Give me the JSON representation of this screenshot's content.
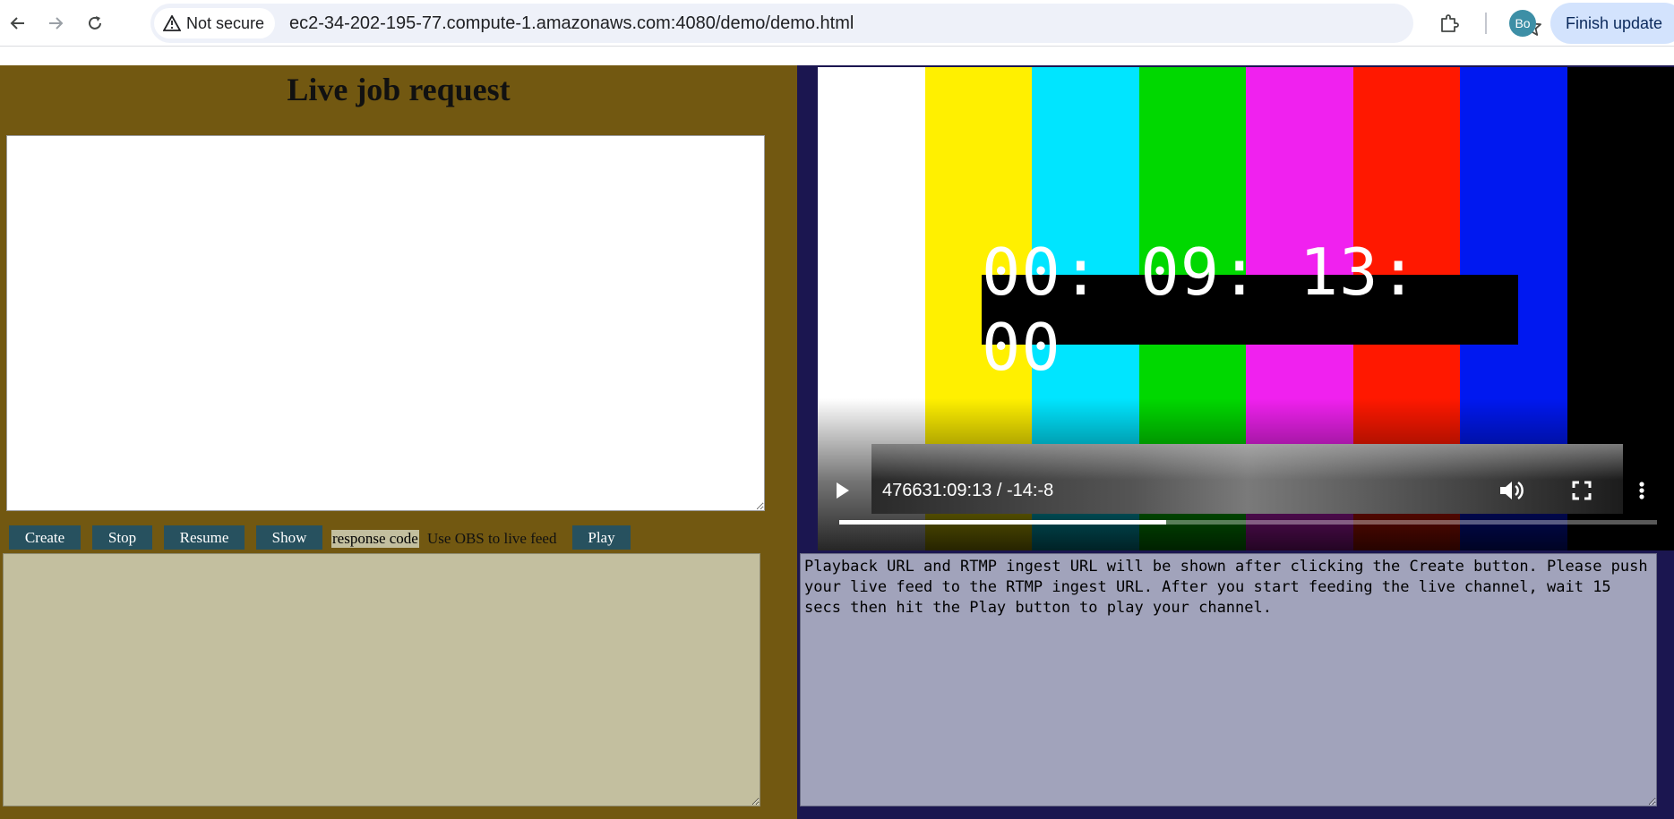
{
  "browser": {
    "security_label": "Not secure",
    "url": "ec2-34-202-195-77.compute-1.amazonaws.com:4080/demo/demo.html",
    "profile_initials": "Bo",
    "update_label": "Finish update"
  },
  "left": {
    "title": "Live job request",
    "job_text": "",
    "buttons": {
      "create": "Create",
      "stop": "Stop",
      "resume": "Resume",
      "show": "Show",
      "play": "Play"
    },
    "response_code_label": "response code",
    "obs_hint": "Use OBS to live feed",
    "response_text": ""
  },
  "video": {
    "timecode": "00: 09: 13: 00",
    "time_display": "476631:09:13 / -14:-8",
    "progress": 0.4,
    "color_bars": [
      "#ffffff",
      "#fff000",
      "#00e5ff",
      "#00d800",
      "#f021ef",
      "#ff1800",
      "#0018f0",
      "#000000"
    ]
  },
  "right": {
    "info_text": "Playback URL and RTMP ingest URL will be shown after clicking the Create button. Please push your live feed to the RTMP ingest URL. After you start feeding the live channel, wait 15 secs then hit the Play button to play your channel."
  }
}
